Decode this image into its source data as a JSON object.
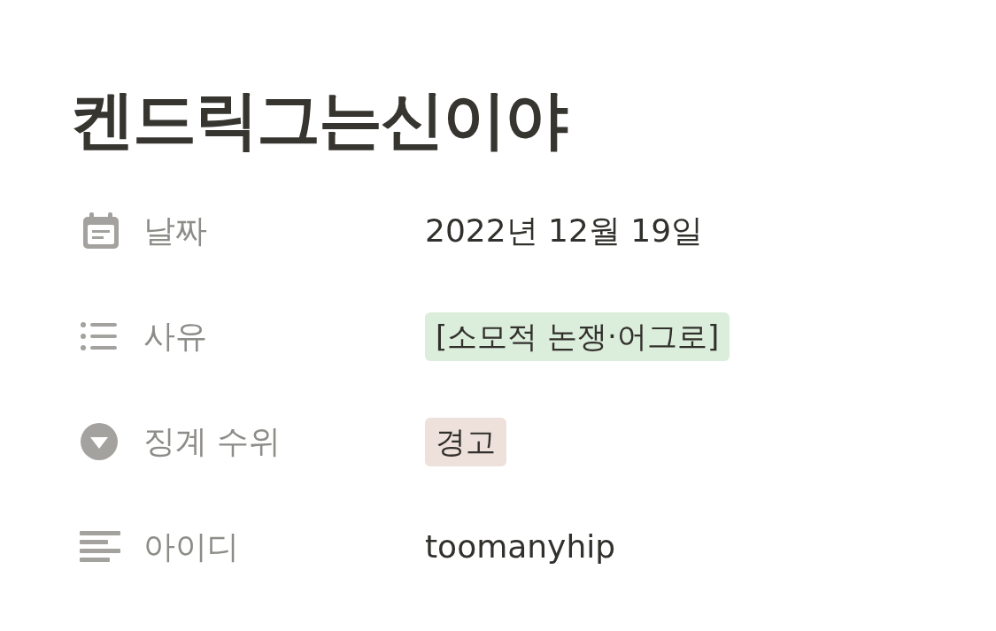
{
  "title": "켄드릭그는신이야",
  "properties": [
    {
      "kind": "date",
      "label": "날짜",
      "value": "2022년 12월 19일"
    },
    {
      "kind": "multi_select",
      "label": "사유",
      "tags": [
        {
          "text": "[소모적 논쟁·어그로]",
          "color": "#dbeddb"
        }
      ]
    },
    {
      "kind": "select",
      "label": "징계 수위",
      "tags": [
        {
          "text": "경고",
          "color": "#eee0da"
        }
      ]
    },
    {
      "kind": "text",
      "label": "아이디",
      "value": "toomanyhip"
    }
  ]
}
